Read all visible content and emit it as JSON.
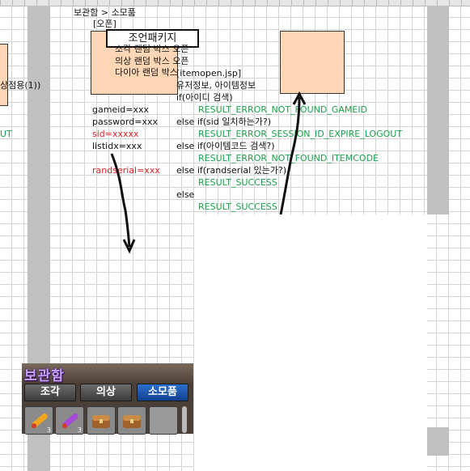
{
  "breadcrumb": "보관함 > 소모품",
  "open_label": "[오픈]",
  "title_box": "조언패키지",
  "left_box_lines": [
    "소각 랜덤 박스 오픈",
    "의상 랜덤 박스 오픈",
    "다이아 랜덤 박스"
  ],
  "left_edge": {
    "text1": "상점용(1))",
    "text2": "UT"
  },
  "params": [
    {
      "text": "gameid=xxx",
      "color": "black"
    },
    {
      "text": "password=xxx",
      "color": "black"
    },
    {
      "text": "sid=xxxxx",
      "color": "red"
    },
    {
      "text": "listidx=xxx",
      "color": "black"
    },
    {
      "text": "randserial=xxx",
      "color": "red"
    }
  ],
  "logic": [
    {
      "text": "[itemopen.jsp]",
      "color": "black"
    },
    {
      "text": "유저정보, 아이템정보",
      "color": "black"
    },
    {
      "text": "if(아이디 검색)",
      "color": "black"
    },
    {
      "text": "RESULT_ERROR_NOT_FOUND_GAMEID",
      "color": "green"
    },
    {
      "text": "else if(sid 일치하는가?)",
      "color": "black"
    },
    {
      "text": "RESULT_ERROR_SESSION_ID_EXPIRE_LOGOUT",
      "color": "green"
    },
    {
      "text": "else if(아이템코드 검색?)",
      "color": "black"
    },
    {
      "text": "RESULT_ERROR_NOT_FOUND_ITEMCODE",
      "color": "green"
    },
    {
      "text": "else if(randserial 있는가?)",
      "color": "black"
    },
    {
      "text": "RESULT_SUCCESS",
      "color": "green"
    },
    {
      "text": "else",
      "color": "black"
    },
    {
      "text": "RESULT_SUCCESS",
      "color": "green"
    }
  ],
  "game_panel": {
    "title": "보관함",
    "tabs": [
      {
        "label": "조각",
        "active": false
      },
      {
        "label": "의상",
        "active": false
      },
      {
        "label": "소모품",
        "active": true
      }
    ],
    "slots": [
      {
        "icon": "scroll-icon-orange",
        "count": "3"
      },
      {
        "icon": "scroll-icon-purple",
        "count": "3"
      },
      {
        "icon": "treasure-chest-icon",
        "count": "0"
      },
      {
        "icon": "treasure-chest-icon",
        "count": "0"
      },
      {
        "icon": "empty-slot",
        "count": ""
      }
    ]
  },
  "colors": {
    "box_fill": "#fdd6b5",
    "green": "#1aa34a",
    "red": "#e0222a",
    "tab_active": "#2b6fd0"
  }
}
